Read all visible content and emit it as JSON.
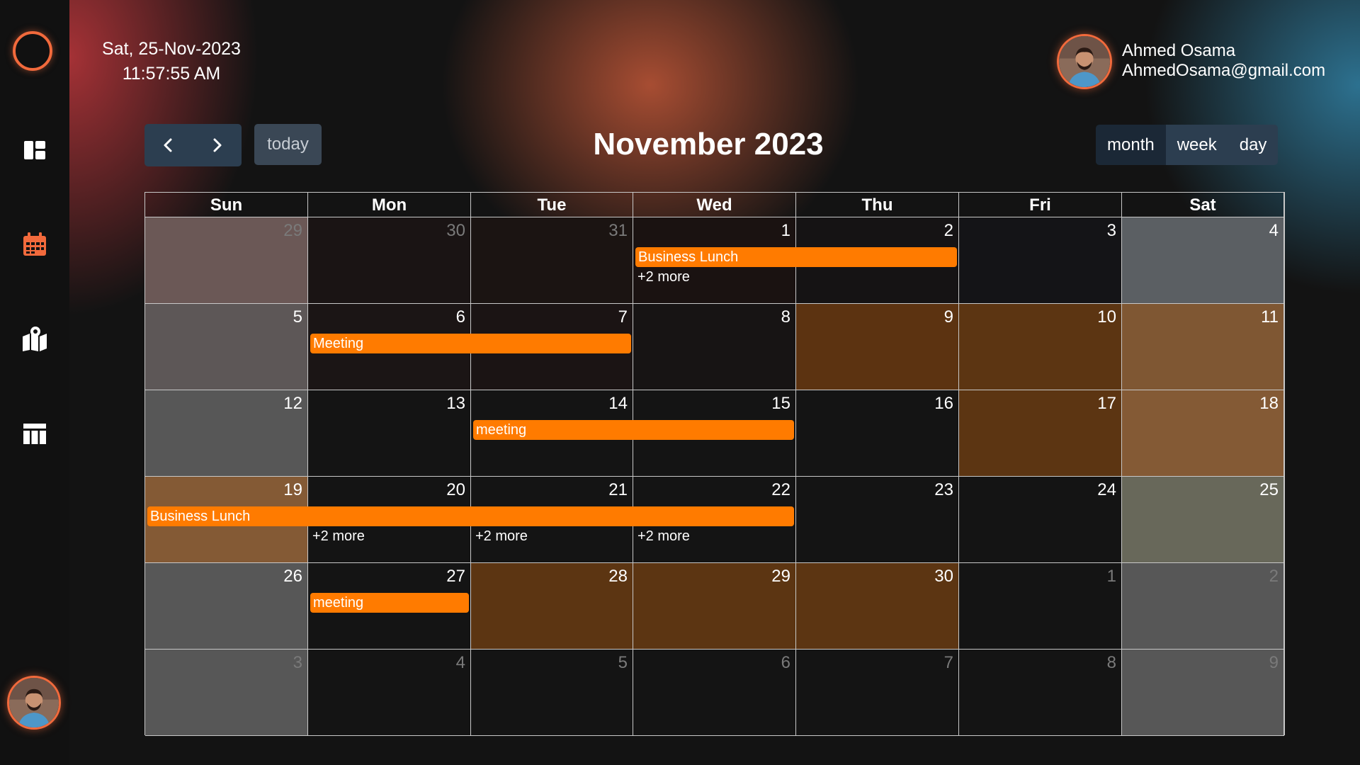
{
  "app": {
    "date": "Sat, 25-Nov-2023",
    "time": "11:57:55 AM"
  },
  "colors": {
    "accent": "#f26a3c",
    "event": "#ff7b00",
    "header_btn": "#2c3e50",
    "today_btn": "#3a4755"
  },
  "sidebar": {
    "items": [
      {
        "icon": "dashboard-icon"
      },
      {
        "icon": "calendar-icon",
        "active": true
      },
      {
        "icon": "map-icon"
      },
      {
        "icon": "table-icon"
      }
    ],
    "avatar": "profile-avatar"
  },
  "user": {
    "name": "Ahmed Osama",
    "email": "AhmedOsama@gmail.com"
  },
  "toolbar": {
    "prev_icon": "chevron-left-icon",
    "next_icon": "chevron-right-icon",
    "today_label": "today",
    "title": "November 2023",
    "views": [
      "month",
      "week",
      "day"
    ],
    "active_view": "month"
  },
  "calendar": {
    "weekdays": [
      "Sun",
      "Mon",
      "Tue",
      "Wed",
      "Thu",
      "Fri",
      "Sat"
    ],
    "weeks": [
      [
        {
          "d": "29",
          "other": true,
          "bg": "#6b5856"
        },
        {
          "d": "30",
          "other": true,
          "bg": "#1a1414"
        },
        {
          "d": "31",
          "other": true,
          "bg": "#1b1412"
        },
        {
          "d": "1",
          "bg": "#1a1211"
        },
        {
          "d": "2",
          "bg": "#151314"
        },
        {
          "d": "3",
          "bg": "#141417"
        },
        {
          "d": "4",
          "bg": "#5b5f63"
        }
      ],
      [
        {
          "d": "5",
          "bg": "#5d5757"
        },
        {
          "d": "6",
          "bg": "#1b1515"
        },
        {
          "d": "7",
          "bg": "#1b1414"
        },
        {
          "d": "8",
          "bg": "#171414"
        },
        {
          "d": "9",
          "bg": "#5c3311"
        },
        {
          "d": "10",
          "bg": "#5c3512"
        },
        {
          "d": "11",
          "bg": "#7f5733"
        }
      ],
      [
        {
          "d": "12",
          "bg": "#575757"
        },
        {
          "d": "13",
          "bg": "#141414"
        },
        {
          "d": "14",
          "bg": "#141414"
        },
        {
          "d": "15",
          "bg": "#141414"
        },
        {
          "d": "16",
          "bg": "#141414"
        },
        {
          "d": "17",
          "bg": "#5c3512"
        },
        {
          "d": "18",
          "bg": "#845a35"
        }
      ],
      [
        {
          "d": "19",
          "bg": "#845a35"
        },
        {
          "d": "20",
          "bg": "#141414"
        },
        {
          "d": "21",
          "bg": "#141414"
        },
        {
          "d": "22",
          "bg": "#141414"
        },
        {
          "d": "23",
          "bg": "#141414"
        },
        {
          "d": "24",
          "bg": "#141414"
        },
        {
          "d": "25",
          "bg": "#68685a"
        }
      ],
      [
        {
          "d": "26",
          "bg": "#575757"
        },
        {
          "d": "27",
          "bg": "#141414"
        },
        {
          "d": "28",
          "bg": "#5c3512"
        },
        {
          "d": "29",
          "bg": "#5c3512"
        },
        {
          "d": "30",
          "bg": "#5c3512"
        },
        {
          "d": "1",
          "other": true,
          "bg": "#141414"
        },
        {
          "d": "2",
          "other": true,
          "bg": "#575757"
        }
      ],
      [
        {
          "d": "3",
          "other": true,
          "bg": "#575757"
        },
        {
          "d": "4",
          "other": true,
          "bg": "#141414"
        },
        {
          "d": "5",
          "other": true,
          "bg": "#141414"
        },
        {
          "d": "6",
          "other": true,
          "bg": "#141414"
        },
        {
          "d": "7",
          "other": true,
          "bg": "#141414"
        },
        {
          "d": "8",
          "other": true,
          "bg": "#141414"
        },
        {
          "d": "9",
          "other": true,
          "bg": "#575757"
        }
      ]
    ],
    "events": [
      {
        "title": "Business Lunch",
        "week": 0,
        "start": 3,
        "end": 4
      },
      {
        "title": "Meeting",
        "week": 1,
        "start": 1,
        "end": 2
      },
      {
        "title": "meeting",
        "week": 2,
        "start": 2,
        "end": 3
      },
      {
        "title": "Business Lunch",
        "week": 3,
        "start": 0,
        "end": 3
      },
      {
        "title": "meeting",
        "week": 4,
        "start": 1,
        "end": 1
      }
    ],
    "more_links": [
      {
        "text": "+2 more",
        "week": 0,
        "day": 3
      },
      {
        "text": "+2 more",
        "week": 3,
        "day": 1
      },
      {
        "text": "+2 more",
        "week": 3,
        "day": 2
      },
      {
        "text": "+2 more",
        "week": 3,
        "day": 3
      }
    ]
  }
}
